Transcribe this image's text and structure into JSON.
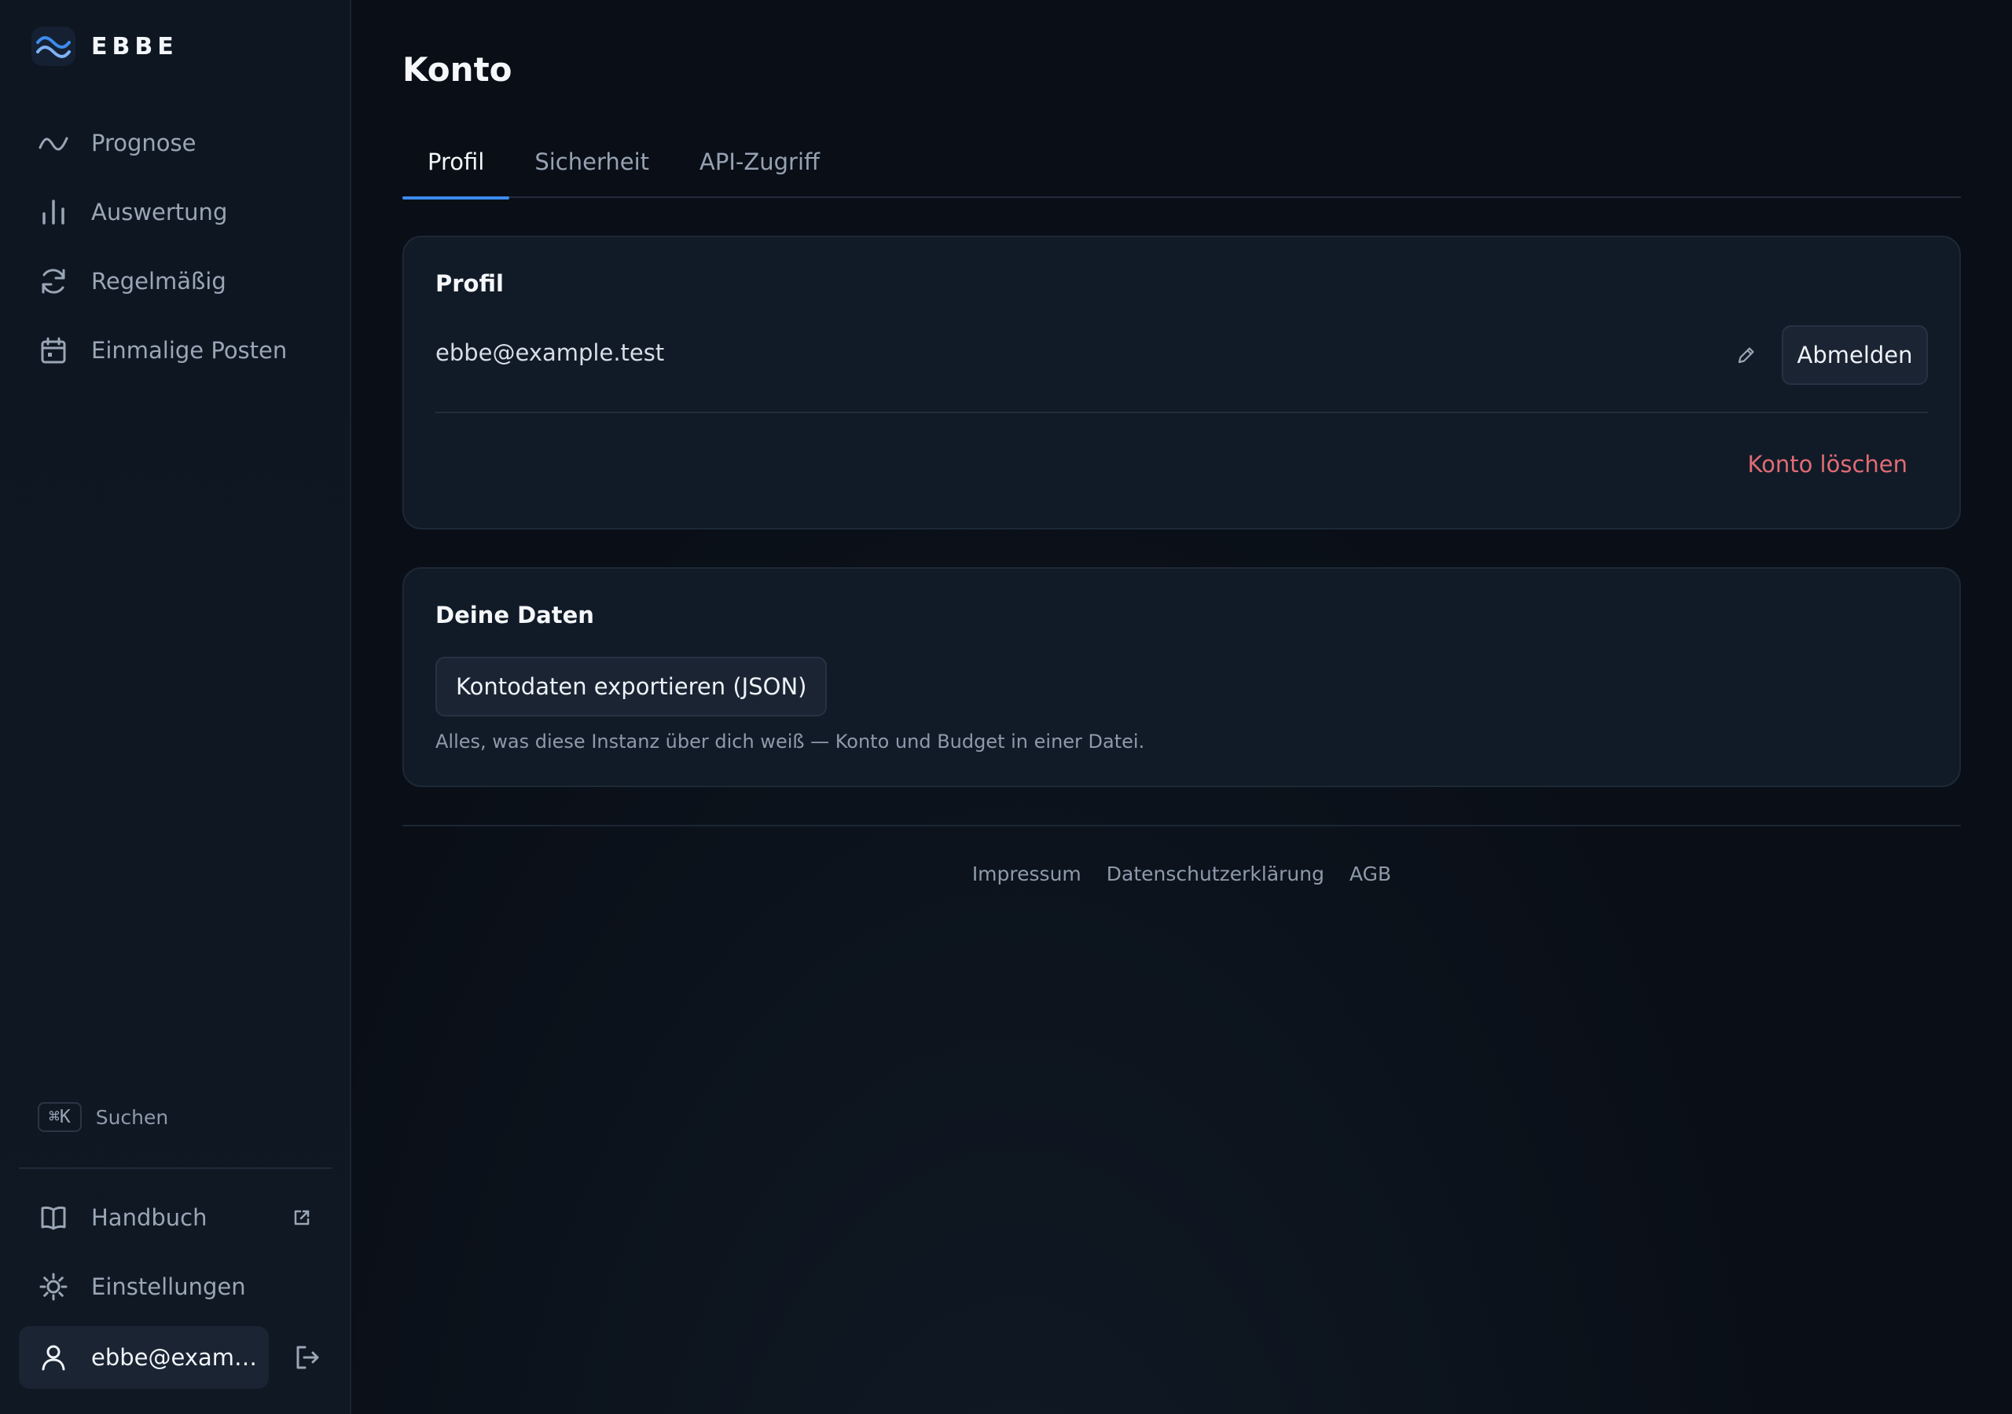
{
  "brand": {
    "name": "EBBE",
    "icon": "wave-icon",
    "accent": "#3d8bf0"
  },
  "sidebar": {
    "items": [
      {
        "label": "Prognose",
        "icon": "trend-line-icon"
      },
      {
        "label": "Auswertung",
        "icon": "bar-chart-icon"
      },
      {
        "label": "Regelmäßig",
        "icon": "refresh-icon"
      },
      {
        "label": "Einmalige Posten",
        "icon": "calendar-icon"
      }
    ],
    "search": {
      "shortcut": "⌘K",
      "label": "Suchen"
    },
    "bottom_items": [
      {
        "label": "Handbuch",
        "icon": "book-icon",
        "external": true
      },
      {
        "label": "Einstellungen",
        "icon": "sun-gear-icon"
      }
    ],
    "user": {
      "label": "ebbe@examp...",
      "icon": "user-icon"
    }
  },
  "main": {
    "title": "Konto",
    "tabs": [
      {
        "label": "Profil",
        "active": true
      },
      {
        "label": "Sicherheit",
        "active": false
      },
      {
        "label": "API-Zugriff",
        "active": false
      }
    ],
    "profile_card": {
      "title": "Profil",
      "email": "ebbe@example.test",
      "signout_label": "Abmelden",
      "delete_label": "Konto löschen",
      "danger_color": "#e06c75"
    },
    "data_card": {
      "title": "Deine Daten",
      "export_label": "Kontodaten exportieren (JSON)",
      "hint": "Alles, was diese Instanz über dich weiß — Konto und Budget in einer Datei."
    },
    "footer": {
      "links": [
        "Impressum",
        "Datenschutzerklärung",
        "AGB"
      ]
    }
  }
}
